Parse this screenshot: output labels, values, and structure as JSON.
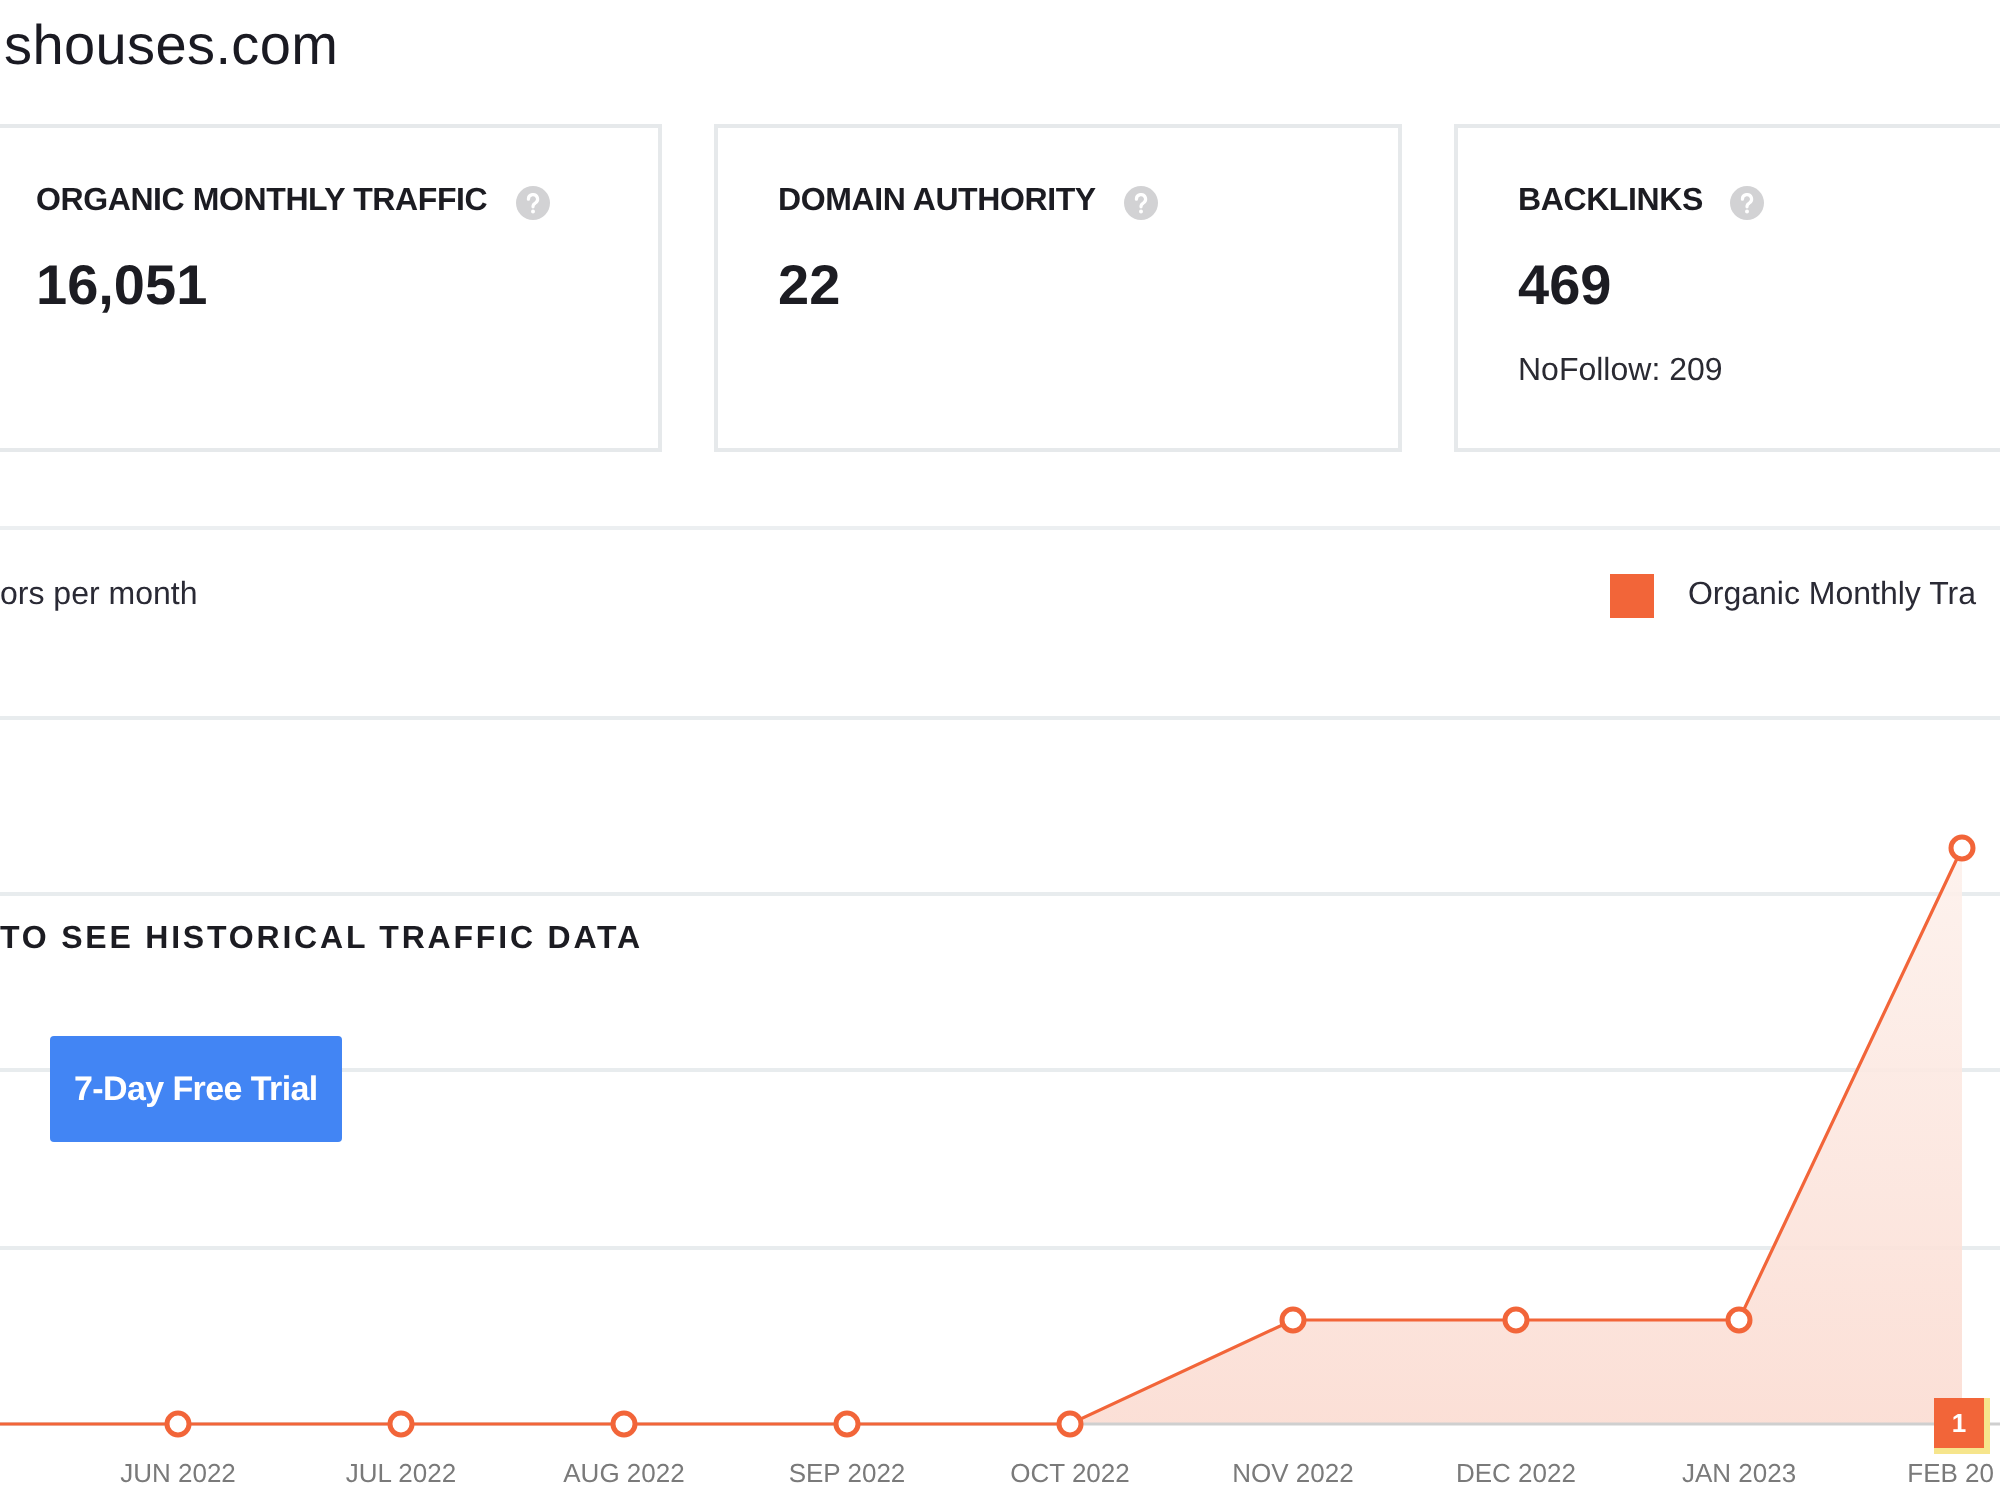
{
  "site": {
    "domain": "shouses.com"
  },
  "metrics": [
    {
      "label": "ORGANIC MONTHLY TRAFFIC",
      "value": "16,051"
    },
    {
      "label": "DOMAIN AUTHORITY",
      "value": "22"
    },
    {
      "label": "BACKLINKS",
      "value": "469",
      "note": "NoFollow: 209"
    }
  ],
  "traffic_panel": {
    "subtitle": "ors per month",
    "legend": [
      {
        "label": "Organic Monthly Tra"
      }
    ],
    "x_labels": [
      "JUN 2022",
      "JUL 2022",
      "AUG 2022",
      "SEP 2022",
      "OCT 2022",
      "NOV 2022",
      "DEC 2022",
      "JAN 2023",
      "FEB 20"
    ],
    "locked_message": "TO SEE HISTORICAL TRAFFIC DATA",
    "trial_button": "7-Day Free Trial"
  },
  "badge": {
    "count": "1"
  }
}
